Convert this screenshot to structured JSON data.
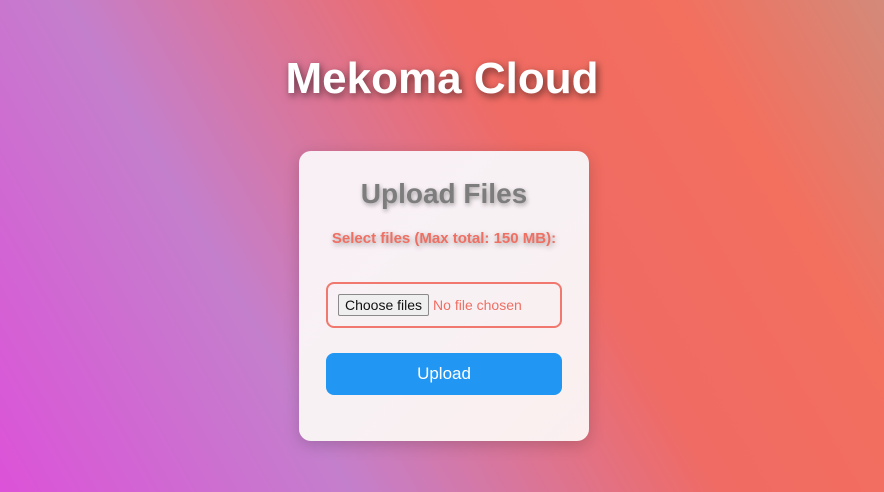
{
  "app": {
    "title": "Mekoma Cloud"
  },
  "upload_card": {
    "title": "Upload Files",
    "select_label": "Select files (Max total: 150 MB):",
    "file_input": {
      "button_label": "Choose files",
      "status_text": "No file chosen"
    },
    "upload_button_label": "Upload"
  },
  "colors": {
    "accent_blue": "#2196f3",
    "accent_coral": "#ef6f63",
    "title_gray": "#7d7d7d"
  }
}
